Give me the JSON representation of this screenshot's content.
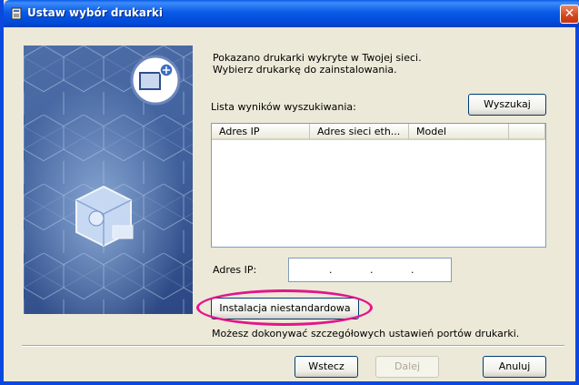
{
  "window": {
    "title": "Ustaw wybór drukarki",
    "close_label": "✕"
  },
  "main": {
    "intro_line1": "Pokazano drukarki wykryte w Twojej sieci.",
    "intro_line2": "Wybierz drukarkę do zainstalowania.",
    "results_label": "Lista wyników wyszukiwania:",
    "search_button": "Wyszukaj",
    "columns": [
      "Adres IP",
      "Adres sieci eth...",
      "Model"
    ],
    "ip_label": "Adres IP:",
    "ip_value": [
      "",
      "",
      "",
      ""
    ],
    "custom_install_button": "Instalacja niestandardowa",
    "custom_install_desc": "Możesz dokonywać szczegółowych ustawień portów drukarki."
  },
  "footer": {
    "back_button": "Wstecz",
    "next_button": "Dalej",
    "cancel_button": "Anuluj"
  },
  "colors": {
    "titlebar": "#0a5ae8",
    "highlight": "#e0168c",
    "side_panel": "#3f5f9b"
  }
}
